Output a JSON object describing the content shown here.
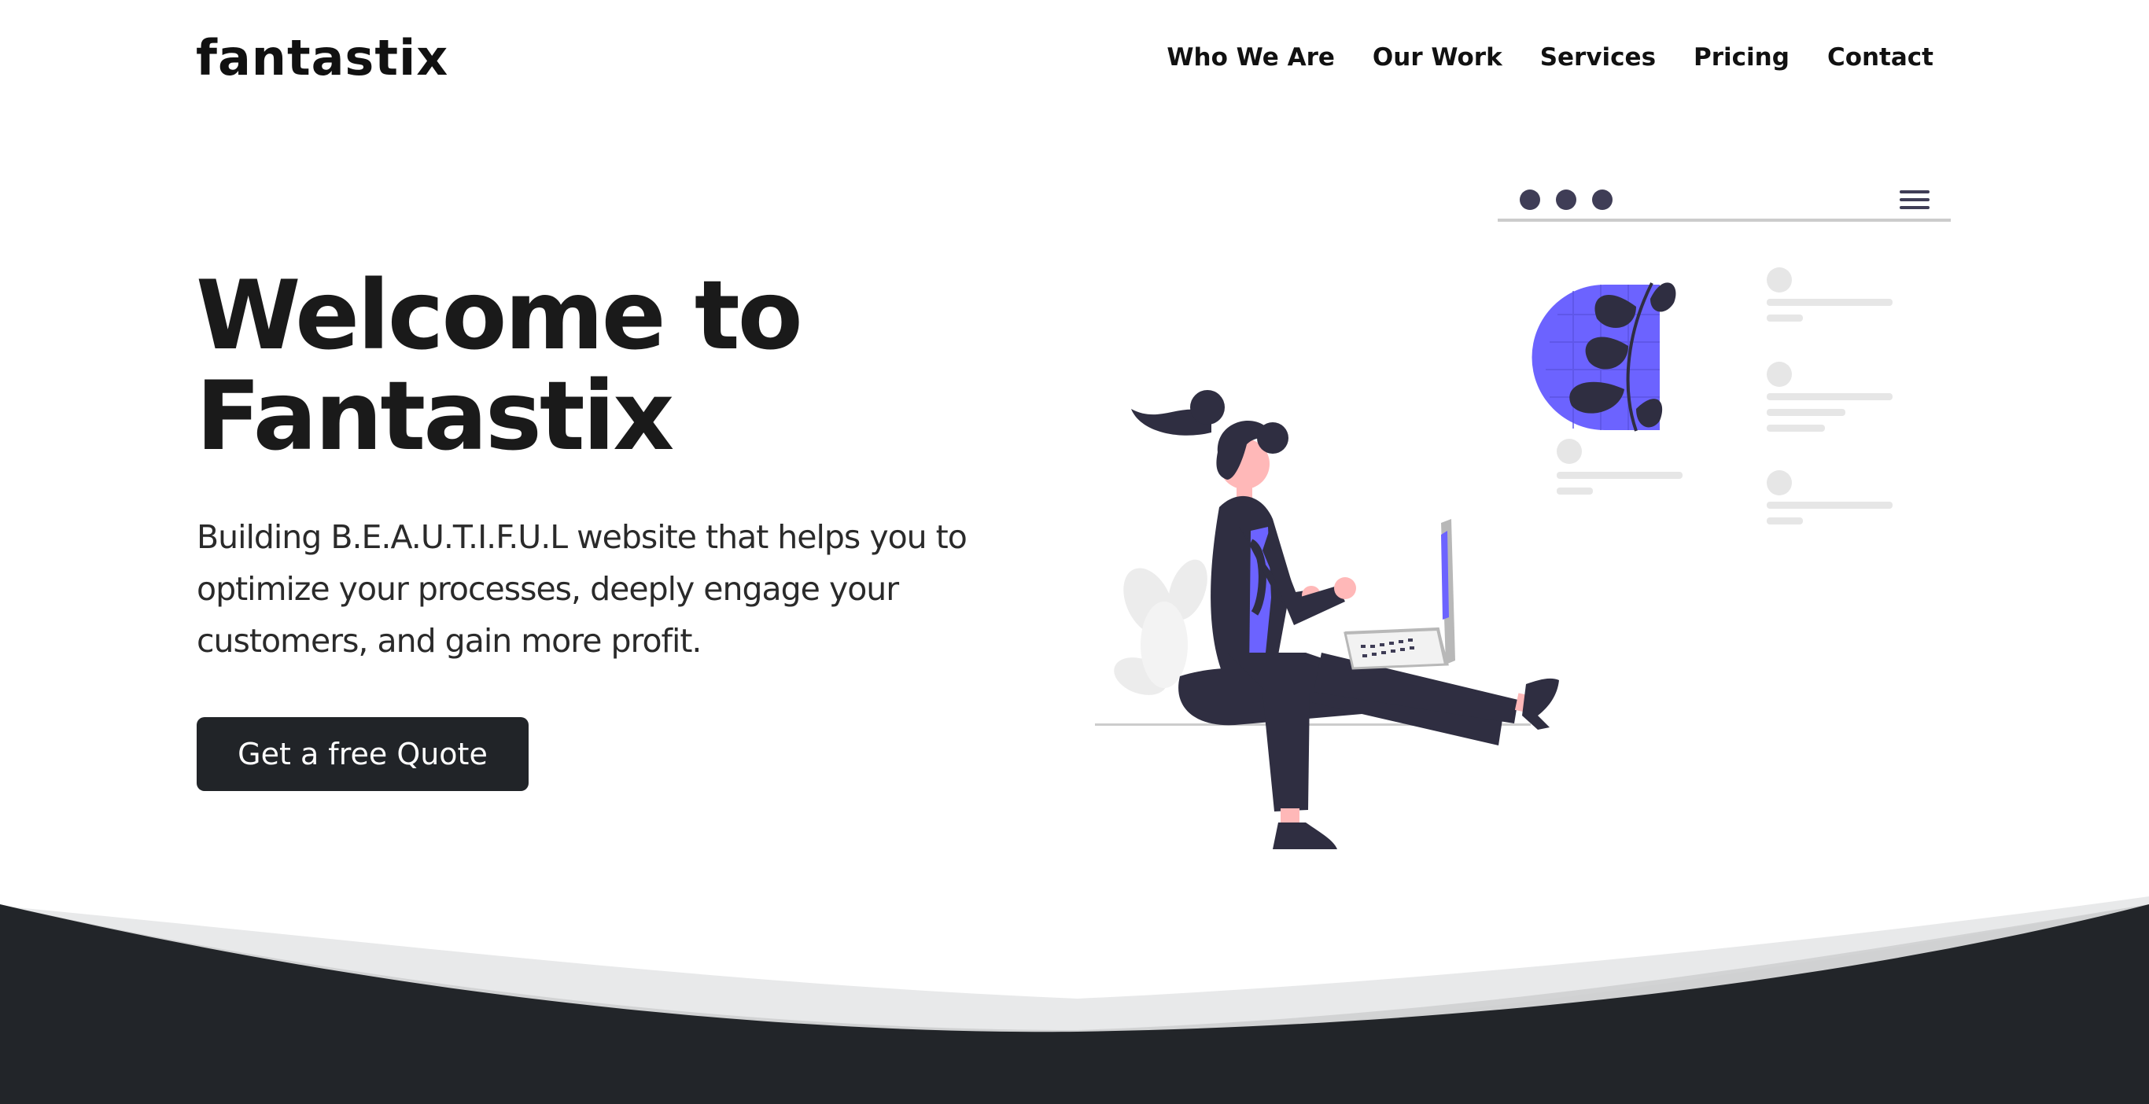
{
  "brand": {
    "logo_text": "fantastix"
  },
  "nav": {
    "items": [
      {
        "label": "Who We Are"
      },
      {
        "label": "Our Work"
      },
      {
        "label": "Services"
      },
      {
        "label": "Pricing"
      },
      {
        "label": "Contact"
      }
    ]
  },
  "hero": {
    "title_line1": "Welcome to",
    "title_line2": "Fantastix",
    "subtitle": "Building B.E.A.U.T.I.F.U.L website that helps you to optimize your processes, deeply engage your customers, and gain more profit.",
    "cta_label": "Get a free Quote"
  },
  "colors": {
    "accent": "#6c63ff",
    "dark": "#212428",
    "figure": "#2f2e41",
    "skin": "#ffb8b8",
    "light_gray": "#e6e6e6"
  },
  "icons": {
    "menu": "hamburger-menu-icon",
    "window_dots": "window-dots-icon"
  }
}
